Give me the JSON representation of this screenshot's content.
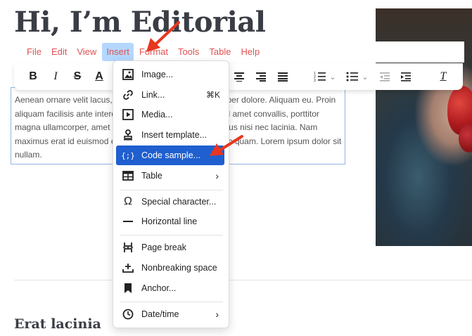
{
  "page": {
    "title": "Hi, I’m Editorial",
    "section_heading": "Erat lacinia"
  },
  "menubar": {
    "items": [
      "File",
      "Edit",
      "View",
      "Insert",
      "Format",
      "Tools",
      "Table",
      "Help"
    ],
    "active": "Insert"
  },
  "toolbar": {
    "buttons": [
      "bold",
      "italic",
      "strikethrough",
      "text-color",
      "align-center",
      "align-right",
      "justify",
      "numbered-list",
      "bullet-list",
      "outdent",
      "indent",
      "clear-formatting"
    ],
    "bold_label": "B",
    "italic_label": "I",
    "strike_label": "S",
    "color_label": "A",
    "clear_label": "T"
  },
  "editor": {
    "text": "Aenean ornare velit lacus, ac varius enim lorem ullamcorper dolore. Aliquam eu. Proin aliquam facilisis ante interdum congue. Integer mollis, nisl amet convallis, porttitor magna ullamcorper, amet egestas mauris. Ut magna finibus nisi nec lacinia. Nam maximus erat id euismod egestas. Pellentesque sapien ac quam. Lorem ipsum dolor sit nullam."
  },
  "insert_menu": {
    "items": [
      {
        "label": "Image...",
        "icon": "image-icon"
      },
      {
        "label": "Link...",
        "icon": "link-icon",
        "shortcut": "⌘K"
      },
      {
        "label": "Media...",
        "icon": "media-icon"
      },
      {
        "label": "Insert template...",
        "icon": "template-icon"
      },
      {
        "label": "Code sample...",
        "icon": "code-sample-icon",
        "highlighted": true
      },
      {
        "label": "Table",
        "icon": "table-icon",
        "submenu": true
      },
      {
        "label": "Special character...",
        "icon": "omega-icon"
      },
      {
        "label": "Horizontal line",
        "icon": "horizontal-line-icon"
      },
      {
        "label": "Page break",
        "icon": "page-break-icon"
      },
      {
        "label": "Nonbreaking space",
        "icon": "nonbreaking-space-icon"
      },
      {
        "label": "Anchor...",
        "icon": "bookmark-icon"
      },
      {
        "label": "Date/time",
        "icon": "clock-icon",
        "submenu": true
      }
    ]
  },
  "colors": {
    "menu_text": "#e05252",
    "active_menu_bg": "#b4d7ff",
    "highlight_bg": "#1f5fcf",
    "annotation_arrow": "#e8361f"
  }
}
